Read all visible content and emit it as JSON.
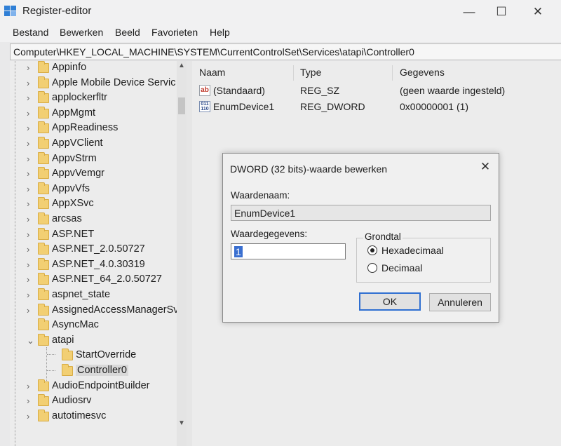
{
  "window": {
    "title": "Register-editor",
    "minimize": "—",
    "maximize": "☐",
    "close": "✕"
  },
  "menu": [
    "Bestand",
    "Bewerken",
    "Beeld",
    "Favorieten",
    "Help"
  ],
  "address": "Computer\\HKEY_LOCAL_MACHINE\\SYSTEM\\CurrentControlSet\\Services\\atapi\\Controller0",
  "tree": {
    "items": [
      {
        "label": "Appinfo",
        "expander": "›",
        "child": false
      },
      {
        "label": "Apple Mobile Device Servic",
        "expander": "›",
        "child": false
      },
      {
        "label": "applockerfltr",
        "expander": "›",
        "child": false
      },
      {
        "label": "AppMgmt",
        "expander": "›",
        "child": false
      },
      {
        "label": "AppReadiness",
        "expander": "›",
        "child": false
      },
      {
        "label": "AppVClient",
        "expander": "›",
        "child": false
      },
      {
        "label": "AppvStrm",
        "expander": "›",
        "child": false
      },
      {
        "label": "AppvVemgr",
        "expander": "›",
        "child": false
      },
      {
        "label": "AppvVfs",
        "expander": "›",
        "child": false
      },
      {
        "label": "AppXSvc",
        "expander": "›",
        "child": false
      },
      {
        "label": "arcsas",
        "expander": "›",
        "child": false
      },
      {
        "label": "ASP.NET",
        "expander": "›",
        "child": false
      },
      {
        "label": "ASP.NET_2.0.50727",
        "expander": "›",
        "child": false
      },
      {
        "label": "ASP.NET_4.0.30319",
        "expander": "›",
        "child": false
      },
      {
        "label": "ASP.NET_64_2.0.50727",
        "expander": "›",
        "child": false
      },
      {
        "label": "aspnet_state",
        "expander": "›",
        "child": false
      },
      {
        "label": "AssignedAccessManagerSv",
        "expander": "›",
        "child": false
      },
      {
        "label": "AsyncMac",
        "expander": "",
        "child": false
      },
      {
        "label": "atapi",
        "expander": "⌄",
        "child": false
      },
      {
        "label": "StartOverride",
        "expander": "",
        "child": true
      },
      {
        "label": "Controller0",
        "expander": "",
        "child": true,
        "selected": true
      },
      {
        "label": "AudioEndpointBuilder",
        "expander": "›",
        "child": false
      },
      {
        "label": "Audiosrv",
        "expander": "›",
        "child": false
      },
      {
        "label": "autotimesvc",
        "expander": "›",
        "child": false
      }
    ],
    "scroll_up": "▲",
    "scroll_down": "▼"
  },
  "list": {
    "headers": {
      "name": "Naam",
      "type": "Type",
      "data": "Gegevens"
    },
    "rows": [
      {
        "icon": "string-value-icon",
        "icon_text": "ab",
        "name": "(Standaard)",
        "type": "REG_SZ",
        "data": "(geen waarde ingesteld)"
      },
      {
        "icon": "binary-value-icon",
        "icon_text": "011 110",
        "name": "EnumDevice1",
        "type": "REG_DWORD",
        "data": "0x00000001 (1)"
      }
    ]
  },
  "dialog": {
    "title": "DWORD (32 bits)-waarde bewerken",
    "close": "✕",
    "value_name_label": "Waardenaam:",
    "value_name": "EnumDevice1",
    "value_data_label": "Waardegegevens:",
    "value_data": "1",
    "base_label": "Grondtal",
    "base_options": [
      "Hexadecimaal",
      "Decimaal"
    ],
    "base_selected": "Hexadecimaal",
    "ok": "OK",
    "cancel": "Annuleren"
  },
  "colors": {
    "folder": "#f2cf73",
    "default_button_border": "#2f6fd1",
    "selection": "#3a6fd0"
  }
}
